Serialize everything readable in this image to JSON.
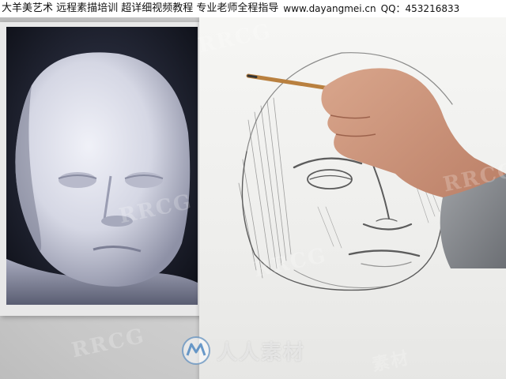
{
  "banner": {
    "course_text": "大羊美艺术 远程素描培训 超详细视频教程 专业老师全程指导",
    "website": "www.dayangmei.cn",
    "qq_label": "QQ：453216833"
  },
  "watermark": {
    "logo_text": "人人素材",
    "repeat_text": "RRCG",
    "repeat_text_2": "素材",
    "logo_icon": "rrcg-logo-icon"
  },
  "scene": {
    "reference_photo": "plaster-face-mask-photo",
    "drawing": "pencil-sketch-of-face-mask",
    "hand": "hand-holding-pencil"
  },
  "colors": {
    "banner_bg": "#ffffff",
    "paper": "#f2f2f0",
    "photo_bg": "#1a1d2a",
    "plaster": "#dfe1ea"
  }
}
